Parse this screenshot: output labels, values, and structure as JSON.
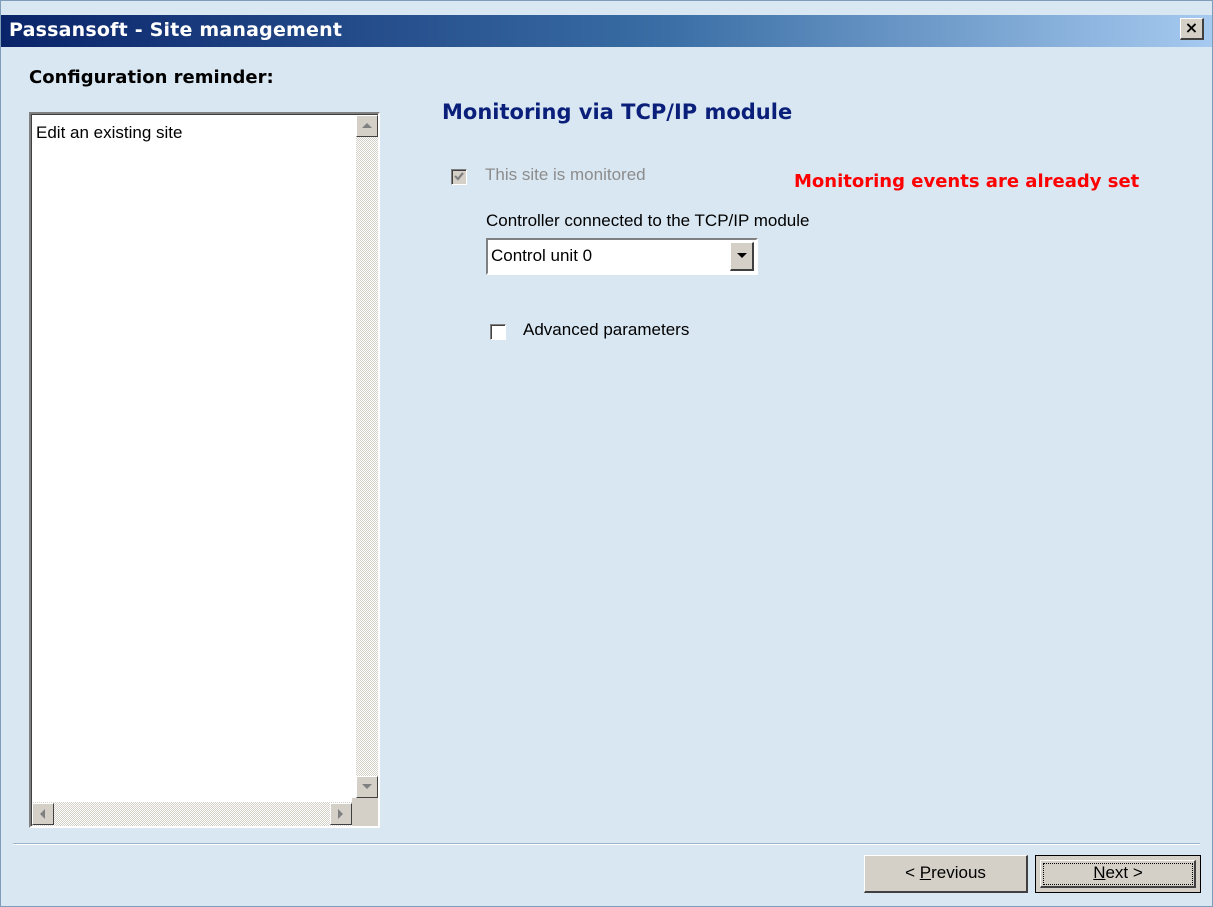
{
  "window": {
    "title": "Passansoft - Site management",
    "close_glyph": "×"
  },
  "left": {
    "header": "Configuration reminder:",
    "list_items": [
      "Edit an existing site"
    ]
  },
  "right": {
    "section_title": "Monitoring via TCP/IP module",
    "monitored": {
      "label": "This site is monitored",
      "checked": true,
      "enabled": false
    },
    "warning": "Monitoring events are already set",
    "controller_label": "Controller connected to the TCP/IP module",
    "controller_value": "Control unit 0",
    "advanced": {
      "label": "Advanced parameters",
      "checked": false
    }
  },
  "footer": {
    "previous_prefix": "< ",
    "previous_accel": "P",
    "previous_rest": "revious",
    "next_accel": "N",
    "next_rest": "ext >"
  },
  "icons": {
    "close": "close-icon",
    "scroll_up": "arrow-up-icon",
    "scroll_down": "arrow-down-icon",
    "scroll_left": "arrow-left-icon",
    "scroll_right": "arrow-right-icon",
    "dropdown": "chevron-down-icon",
    "check": "check-icon"
  },
  "colors": {
    "warning": "#ff0000",
    "section_title": "#0a1f7a",
    "background": "#d9e7f2",
    "disabled_text": "#8c8c8c"
  }
}
